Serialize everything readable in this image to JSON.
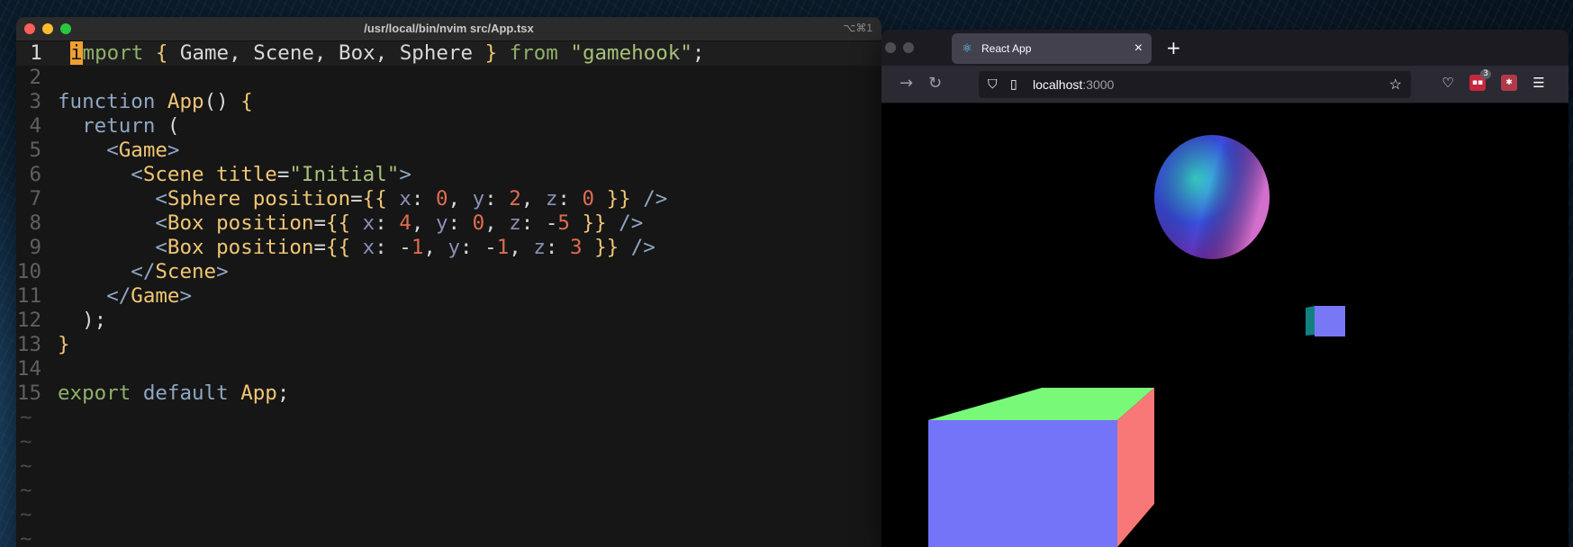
{
  "terminal": {
    "title": "/usr/local/bin/nvim src/App.tsx",
    "shortcut": "⌥⌘1"
  },
  "editor": {
    "lines": [
      {
        "n": "1",
        "tokens": [
          [
            "cursor",
            "i"
          ],
          [
            "kw2",
            "mport"
          ],
          [
            "pun",
            " "
          ],
          [
            "br",
            "{"
          ],
          [
            "pun",
            " Game, Scene, Box, Sphere "
          ],
          [
            "br",
            "}"
          ],
          [
            "pun",
            " "
          ],
          [
            "kw2",
            "from"
          ],
          [
            "pun",
            " "
          ],
          [
            "str",
            "\"gamehook\""
          ],
          [
            "pun",
            ";"
          ]
        ]
      },
      {
        "n": "2",
        "tokens": []
      },
      {
        "n": "3",
        "tokens": [
          [
            "kw",
            "function"
          ],
          [
            "pun",
            " "
          ],
          [
            "fn",
            "App"
          ],
          [
            "pun",
            "() "
          ],
          [
            "br",
            "{"
          ]
        ]
      },
      {
        "n": "4",
        "tokens": [
          [
            "pun",
            "  "
          ],
          [
            "kw",
            "return"
          ],
          [
            "pun",
            " ("
          ]
        ]
      },
      {
        "n": "5",
        "tokens": [
          [
            "pun",
            "    "
          ],
          [
            "ang",
            "<"
          ],
          [
            "tag",
            "Game"
          ],
          [
            "ang",
            ">"
          ]
        ]
      },
      {
        "n": "6",
        "tokens": [
          [
            "pun",
            "      "
          ],
          [
            "ang",
            "<"
          ],
          [
            "tag",
            "Scene"
          ],
          [
            "pun",
            " "
          ],
          [
            "attr",
            "title"
          ],
          [
            "pun",
            "="
          ],
          [
            "str",
            "\"Initial\""
          ],
          [
            "ang",
            ">"
          ]
        ]
      },
      {
        "n": "7",
        "tokens": [
          [
            "pun",
            "        "
          ],
          [
            "ang",
            "<"
          ],
          [
            "tag",
            "Sphere"
          ],
          [
            "pun",
            " "
          ],
          [
            "attr",
            "position"
          ],
          [
            "pun",
            "="
          ],
          [
            "br",
            "{{"
          ],
          [
            "pun",
            " "
          ],
          [
            "prop",
            "x"
          ],
          [
            "pun",
            ": "
          ],
          [
            "num",
            "0"
          ],
          [
            "pun",
            ", "
          ],
          [
            "prop",
            "y"
          ],
          [
            "pun",
            ": "
          ],
          [
            "num",
            "2"
          ],
          [
            "pun",
            ", "
          ],
          [
            "prop",
            "z"
          ],
          [
            "pun",
            ": "
          ],
          [
            "num",
            "0"
          ],
          [
            "pun",
            " "
          ],
          [
            "br",
            "}}"
          ],
          [
            "pun",
            " "
          ],
          [
            "ang",
            "/>"
          ]
        ]
      },
      {
        "n": "8",
        "tokens": [
          [
            "pun",
            "        "
          ],
          [
            "ang",
            "<"
          ],
          [
            "tag",
            "Box"
          ],
          [
            "pun",
            " "
          ],
          [
            "attr",
            "position"
          ],
          [
            "pun",
            "="
          ],
          [
            "br",
            "{{"
          ],
          [
            "pun",
            " "
          ],
          [
            "prop",
            "x"
          ],
          [
            "pun",
            ": "
          ],
          [
            "num",
            "4"
          ],
          [
            "pun",
            ", "
          ],
          [
            "prop",
            "y"
          ],
          [
            "pun",
            ": "
          ],
          [
            "num",
            "0"
          ],
          [
            "pun",
            ", "
          ],
          [
            "prop",
            "z"
          ],
          [
            "pun",
            ": -"
          ],
          [
            "num",
            "5"
          ],
          [
            "pun",
            " "
          ],
          [
            "br",
            "}}"
          ],
          [
            "pun",
            " "
          ],
          [
            "ang",
            "/>"
          ]
        ]
      },
      {
        "n": "9",
        "tokens": [
          [
            "pun",
            "        "
          ],
          [
            "ang",
            "<"
          ],
          [
            "tag",
            "Box"
          ],
          [
            "pun",
            " "
          ],
          [
            "attr",
            "position"
          ],
          [
            "pun",
            "="
          ],
          [
            "br",
            "{{"
          ],
          [
            "pun",
            " "
          ],
          [
            "prop",
            "x"
          ],
          [
            "pun",
            ": -"
          ],
          [
            "num",
            "1"
          ],
          [
            "pun",
            ", "
          ],
          [
            "prop",
            "y"
          ],
          [
            "pun",
            ": -"
          ],
          [
            "num",
            "1"
          ],
          [
            "pun",
            ", "
          ],
          [
            "prop",
            "z"
          ],
          [
            "pun",
            ": "
          ],
          [
            "num",
            "3"
          ],
          [
            "pun",
            " "
          ],
          [
            "br",
            "}}"
          ],
          [
            "pun",
            " "
          ],
          [
            "ang",
            "/>"
          ]
        ]
      },
      {
        "n": "10",
        "tokens": [
          [
            "pun",
            "      "
          ],
          [
            "ang",
            "</"
          ],
          [
            "tag",
            "Scene"
          ],
          [
            "ang",
            ">"
          ]
        ]
      },
      {
        "n": "11",
        "tokens": [
          [
            "pun",
            "    "
          ],
          [
            "ang",
            "</"
          ],
          [
            "tag",
            "Game"
          ],
          [
            "ang",
            ">"
          ]
        ]
      },
      {
        "n": "12",
        "tokens": [
          [
            "pun",
            "  );"
          ]
        ]
      },
      {
        "n": "13",
        "tokens": [
          [
            "br",
            "}"
          ]
        ]
      },
      {
        "n": "14",
        "tokens": []
      },
      {
        "n": "15",
        "tokens": [
          [
            "kw2",
            "export"
          ],
          [
            "pun",
            " "
          ],
          [
            "kw",
            "default"
          ],
          [
            "pun",
            " "
          ],
          [
            "fn",
            "App"
          ],
          [
            "pun",
            ";"
          ]
        ]
      }
    ],
    "tilde_rows": [
      "~",
      "~",
      "~",
      "~",
      "~",
      "~"
    ]
  },
  "browser": {
    "tab_title": "React App",
    "tab_close": "×",
    "new_tab": "+",
    "url_host": "localhost",
    "url_port": ":3000",
    "extension_badge": "3"
  },
  "scene_colors": {
    "box_front": "#7474f8",
    "box_top": "#78fa78",
    "box_side": "#f87878",
    "small_box_front": "#7878f6",
    "small_box_side": "#127f80",
    "sphere_top": "#3ae3d4",
    "sphere_left": "#3a4fe0",
    "sphere_right": "#e47ad0",
    "sphere_bottom": "#8a1a9a"
  }
}
